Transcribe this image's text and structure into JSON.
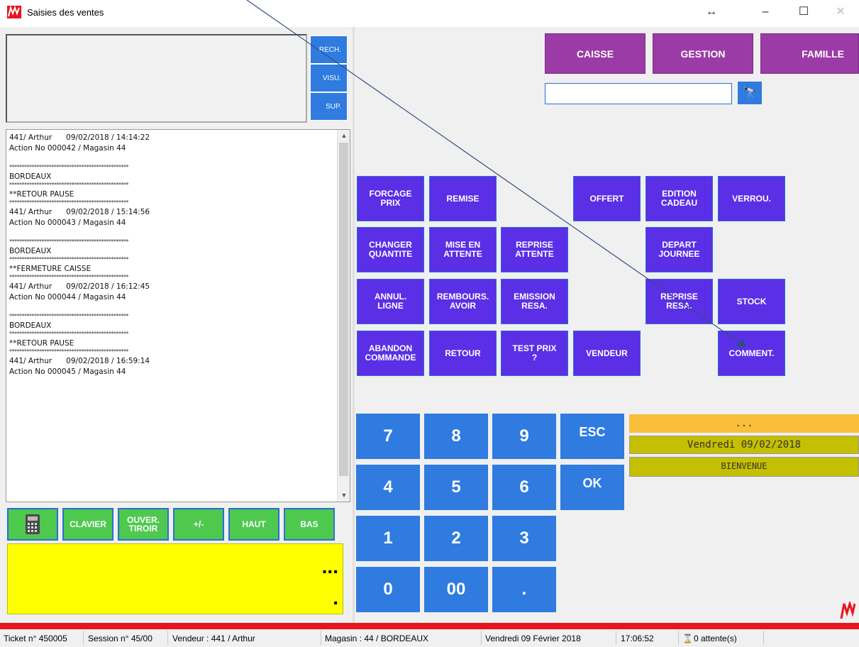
{
  "window": {
    "title": "Saisies des ventes",
    "resize_glyph": "↔",
    "minimize": "–",
    "maximize": "☐",
    "close": "✕"
  },
  "left": {
    "side_buttons": [
      "RECH.",
      "VISU.",
      "SUP."
    ],
    "log": [
      {
        "kind": "line",
        "text": "441/ Arthur      09/02/2018 / 14:14:22"
      },
      {
        "kind": "line",
        "text": "Action No 000042 / Magasin 44"
      },
      {
        "kind": "blank",
        "text": ""
      },
      {
        "kind": "stars",
        "text": "************************************************"
      },
      {
        "kind": "line",
        "text": "BORDEAUX"
      },
      {
        "kind": "stars",
        "text": "************************************************"
      },
      {
        "kind": "line",
        "text": "**RETOUR PAUSE"
      },
      {
        "kind": "stars",
        "text": "************************************************"
      },
      {
        "kind": "line",
        "text": "441/ Arthur      09/02/2018 / 15:14:56"
      },
      {
        "kind": "line",
        "text": "Action No 000043 / Magasin 44"
      },
      {
        "kind": "blank",
        "text": ""
      },
      {
        "kind": "stars",
        "text": "************************************************"
      },
      {
        "kind": "line",
        "text": "BORDEAUX"
      },
      {
        "kind": "stars",
        "text": "************************************************"
      },
      {
        "kind": "line",
        "text": "**FERMETURE CAISSE"
      },
      {
        "kind": "stars",
        "text": "************************************************"
      },
      {
        "kind": "line",
        "text": "441/ Arthur      09/02/2018 / 16:12:45"
      },
      {
        "kind": "line",
        "text": "Action No 000044 / Magasin 44"
      },
      {
        "kind": "blank",
        "text": ""
      },
      {
        "kind": "stars",
        "text": "************************************************"
      },
      {
        "kind": "line",
        "text": "BORDEAUX"
      },
      {
        "kind": "stars",
        "text": "************************************************"
      },
      {
        "kind": "line",
        "text": "**RETOUR PAUSE"
      },
      {
        "kind": "stars",
        "text": "************************************************"
      },
      {
        "kind": "line",
        "text": "441/ Arthur      09/02/2018 / 16:59:14"
      },
      {
        "kind": "line",
        "text": "Action No 000045 / Magasin 44"
      }
    ],
    "green_buttons": {
      "clavier": "CLAVIER",
      "ouver_1": "OUVER.",
      "ouver_2": "TIROIR",
      "plusminus": "+/-",
      "haut": "HAUT",
      "bas": "BAS"
    },
    "display": {
      "line1": "...",
      "line2": "."
    }
  },
  "right": {
    "top_buttons": {
      "caisse": "CAISSE",
      "gestion": "GESTION",
      "famille": "FAMILLE"
    },
    "search_value": "",
    "search_icon_glyph": "🔭",
    "actions": {
      "forcage": [
        "FORCAGE",
        "PRIX"
      ],
      "remise": [
        "REMISE"
      ],
      "offert": [
        "OFFERT"
      ],
      "edition": [
        "EDITION",
        "CADEAU"
      ],
      "verrou": [
        "VERROU."
      ],
      "changer": [
        "CHANGER",
        "QUANTITE"
      ],
      "mise": [
        "MISE EN",
        "ATTENTE"
      ],
      "reprise_att": [
        "REPRISE",
        "ATTENTE"
      ],
      "depart": [
        "DEPART",
        "JOURNEE"
      ],
      "annul": [
        "ANNUL.",
        "LIGNE"
      ],
      "rembours": [
        "REMBOURS.",
        "AVOIR"
      ],
      "emission": [
        "EMISSION",
        "RESA."
      ],
      "reprise_resa": [
        "REPRISE",
        "RESA."
      ],
      "stock": [
        "STOCK"
      ],
      "abandon": [
        "ABANDON",
        "COMMANDE"
      ],
      "retour": [
        "RETOUR"
      ],
      "testprix": [
        "TEST PRIX",
        "?"
      ],
      "vendeur": [
        "VENDEUR"
      ],
      "comment": [
        "COMMENT."
      ]
    },
    "keypad": {
      "k7": "7",
      "k8": "8",
      "k9": "9",
      "esc": "ESC",
      "k4": "4",
      "k5": "5",
      "k6": "6",
      "ok": "OK",
      "k1": "1",
      "k2": "2",
      "k3": "3",
      "k0": "0",
      "k00": "00",
      "dot": "."
    },
    "info": {
      "top": "...",
      "date": "Vendredi 09/02/2018",
      "welcome": "BIENVENUE"
    }
  },
  "status": {
    "ticket": "Ticket n° 450005",
    "session": "Session n° 45/00",
    "vendeur": "Vendeur : 441 / Arthur",
    "magasin": "Magasin : 44 / BORDEAUX",
    "date": "Vendredi 09 Février 2018",
    "time": "17:06:52",
    "attente": "0 attente(s)"
  },
  "colors": {
    "purple": "#9b3ca6",
    "action": "#5a2fe6",
    "keypad": "#2f7be0",
    "green": "#4ec94e",
    "display": "#ffff00",
    "info_orange": "#f9bf3a",
    "info_olive": "#c4bf00",
    "brand_red": "#e8141e"
  }
}
